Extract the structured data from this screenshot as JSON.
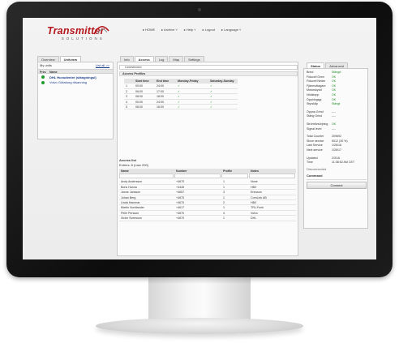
{
  "header": {
    "logo_main": "Transmitter",
    "logo_sub": "SOLUTIONS",
    "nav": [
      "▸ HOME",
      "▸ Archive ˅",
      "▸ Help ˅",
      "▸ Logout",
      "▸ Language ˅"
    ]
  },
  "left_panel": {
    "tabs": [
      "Overview",
      "Unitview"
    ],
    "active_tab": "Unitview",
    "title": "My units",
    "list_all": "List all >>",
    "columns": [
      "Pres",
      "Name"
    ],
    "units": [
      {
        "name": "DHL Huvudentré (stängningsl)",
        "status": "online"
      },
      {
        "name": "Volvo Götaborg ritsanning",
        "status": "online"
      }
    ]
  },
  "center_panel": {
    "tabs": [
      "Info",
      "Access",
      "Log",
      "Map",
      "Settings"
    ],
    "active_tab": "Access",
    "unrestricted_label": "Unrestricted",
    "access_profiles_title": "Access Profiles",
    "profile_columns": [
      "",
      "Start time",
      "End time",
      "Monday-Friday",
      "Saturday-Sunday"
    ],
    "profiles": [
      [
        "1",
        "00:00",
        "24:00",
        "✓",
        "✓"
      ],
      [
        "2",
        "06:00",
        "17:00",
        "✓",
        "✓"
      ],
      [
        "3",
        "08:00",
        "18:00",
        "✓",
        "✓"
      ],
      [
        "4",
        "00:00",
        "24:00",
        "✓",
        "✓"
      ],
      [
        "5",
        "08:00",
        "16:00",
        "✓",
        "✓"
      ]
    ],
    "access_list_title": "Access list",
    "entries_label": "Entries: 8 (max 200)",
    "acl_columns": [
      "Name",
      "Number",
      "Profile",
      "Notes"
    ],
    "acl_rows": [
      [
        "Andy Andersson",
        "+4670",
        "1",
        "None"
      ],
      [
        "Boris Hanna",
        "+4445",
        "1",
        "HBX"
      ],
      [
        "Janne Jansson",
        "+4657",
        "3",
        "Ericsson"
      ],
      [
        "Johan Berg",
        "+4670",
        "1",
        "ComLink AB"
      ],
      [
        "Linda Hammar",
        "+4670",
        "2",
        "HBX"
      ],
      [
        "Martin Nordlander",
        "+4617",
        "1",
        "TRL-Funk"
      ],
      [
        "Pelle Persson",
        "+4670",
        "4",
        "Volvo"
      ],
      [
        "Victor Svensson",
        "+4670",
        "1",
        "DHL"
      ]
    ]
  },
  "right_panel": {
    "tabs": [
      "Status",
      "Advanced"
    ],
    "active_tab": "Status",
    "status_rows": [
      {
        "k": "Brind",
        "v": "Stängd",
        "ok": true
      },
      {
        "k": "Fiducell Öven",
        "v": "OK",
        "ok": true
      },
      {
        "k": "Fiducell Nedre",
        "v": "OK",
        "ok": true
      },
      {
        "k": "Fjärrmottagare",
        "v": "OK",
        "ok": true
      },
      {
        "k": "Motorskydd",
        "v": "OK",
        "ok": true
      },
      {
        "k": "Nödstopp",
        "v": "OK",
        "ok": true
      },
      {
        "k": "Öppningsgr.",
        "v": "OK",
        "ok": true
      },
      {
        "k": "Styrskåp",
        "v": "Stängt",
        "ok": true
      }
    ],
    "mid_rows": [
      {
        "k": "Öppna Grind",
        "v": "----",
        "ok": false
      },
      {
        "k": "Stäng Grind",
        "v": "----",
        "ok": false
      }
    ],
    "signal_rows": [
      {
        "k": "Strömförsörjning",
        "v": "OK",
        "ok": true
      },
      {
        "k": "Signal level",
        "v": "----",
        "ok": false
      }
    ],
    "counter_rows": [
      {
        "k": "Total Counter",
        "v": "209692",
        "ok": false
      },
      {
        "k": "Since service",
        "v": "5012 (30 %)",
        "ok": false
      },
      {
        "k": "Last Service",
        "v": "1/26/16",
        "ok": false
      },
      {
        "k": "Next service",
        "v": "1/26/17",
        "ok": false
      }
    ],
    "time_rows": [
      {
        "k": "Updated",
        "v": "2/3/16",
        "ok": false
      },
      {
        "k": "Time",
        "v": "11:38:52 AM CET",
        "ok": false
      }
    ],
    "disconnected_label": "Disconnected",
    "command_title": "Command",
    "connect_label": "Connect"
  }
}
